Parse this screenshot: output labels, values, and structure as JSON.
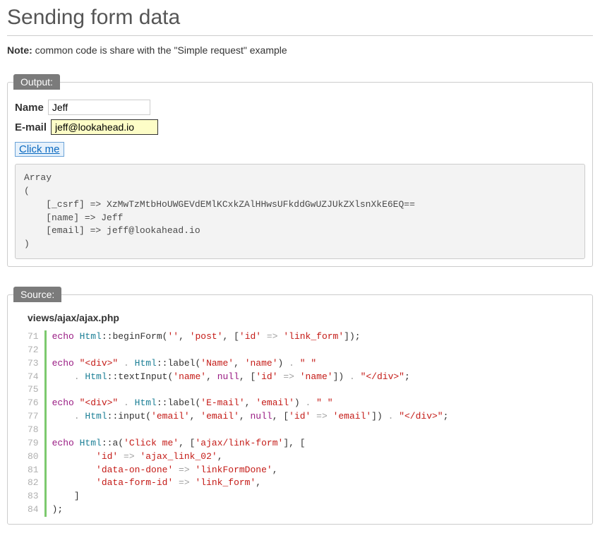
{
  "title": "Sending form data",
  "noteLabel": "Note:",
  "noteText": " common code is share with the \"Simple request\" example",
  "outputLegend": "Output:",
  "sourceLegend": "Source:",
  "nameLabel": "Name",
  "nameValue": "Jeff",
  "emailLabel": "E-mail",
  "emailValue": "jeff@lookahead.io",
  "clickLabel": "Click me",
  "responseText": "Array\n(\n    [_csrf] => XzMwTzMtbHoUWGEVdEMlKCxkZAlHHwsUFkddGwUZJUkZXlsnXkE6EQ==\n    [name] => Jeff\n    [email] => jeff@lookahead.io\n)",
  "fileName": "views/ajax/ajax.php",
  "lineNumbers": [
    "71",
    "72",
    "73",
    "74",
    "75",
    "76",
    "77",
    "78",
    "79",
    "80",
    "81",
    "82",
    "83",
    "84"
  ],
  "code": {
    "l71": {
      "echo": "echo ",
      "cls": "Html",
      "m": "::beginForm(",
      "a1": "''",
      "c1": ", ",
      "a2": "'post'",
      "c2": ", [",
      "k": "'id'",
      "ar": " => ",
      "v": "'link_form'",
      "end": "]);"
    },
    "l73": {
      "echo": "echo ",
      "s1": "\"<div>\"",
      "dot1": " . ",
      "cls": "Html",
      "m1": "::label(",
      "a1": "'Name'",
      "c1": ", ",
      "a2": "'name'",
      "m1e": ")",
      "dot2": " . ",
      "sp": "\" \""
    },
    "l74": {
      "dot1": "    . ",
      "cls": "Html",
      "m": "::textInput(",
      "a1": "'name'",
      "c1": ", ",
      "nul": "null",
      "c2": ", [",
      "k": "'id'",
      "ar": " => ",
      "v": "'name'",
      "br": "])",
      "dot2": " . ",
      "s2": "\"</div>\"",
      "semi": ";"
    },
    "l76": {
      "echo": "echo ",
      "s1": "\"<div>\"",
      "dot1": " . ",
      "cls": "Html",
      "m1": "::label(",
      "a1": "'E-mail'",
      "c1": ", ",
      "a2": "'email'",
      "m1e": ")",
      "dot2": " . ",
      "sp": "\" \""
    },
    "l77": {
      "dot1": "    . ",
      "cls": "Html",
      "m": "::input(",
      "a1": "'email'",
      "c1": ", ",
      "a2": "'email'",
      "c2": ", ",
      "nul": "null",
      "c3": ", [",
      "k": "'id'",
      "ar": " => ",
      "v": "'email'",
      "br": "])",
      "dot2": " . ",
      "s2": "\"</div>\"",
      "semi": ";"
    },
    "l79": {
      "echo": "echo ",
      "cls": "Html",
      "m": "::a(",
      "a1": "'Click me'",
      "c1": ", [",
      "a2": "'ajax/link-form'",
      "c2": "], ["
    },
    "l80": {
      "pad": "        ",
      "k": "'id'",
      "ar": " => ",
      "v": "'ajax_link_02'",
      "c": ","
    },
    "l81": {
      "pad": "        ",
      "k": "'data-on-done'",
      "ar": " => ",
      "v": "'linkFormDone'",
      "c": ","
    },
    "l82": {
      "pad": "        ",
      "k": "'data-form-id'",
      "ar": " => ",
      "v": "'link_form'",
      "c": ","
    },
    "l83": {
      "pad": "    ",
      "b": "]"
    },
    "l84": {
      "pad": "",
      "b": ");"
    }
  }
}
